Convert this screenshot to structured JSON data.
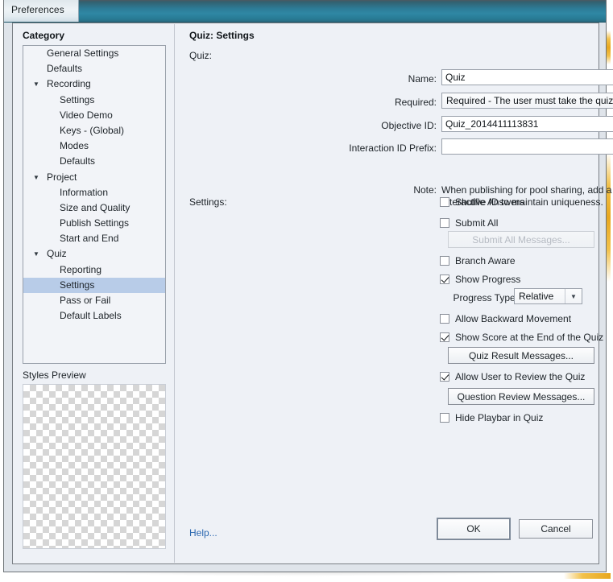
{
  "window": {
    "title": "Preferences"
  },
  "sidebar": {
    "header": "Category",
    "items": [
      {
        "label": "General Settings",
        "depth": 0,
        "twisty": "",
        "selected": false
      },
      {
        "label": "Defaults",
        "depth": 0,
        "twisty": "",
        "selected": false
      },
      {
        "label": "Recording",
        "depth": 0,
        "twisty": "▼",
        "selected": false
      },
      {
        "label": "Settings",
        "depth": 1,
        "twisty": "",
        "selected": false
      },
      {
        "label": "Video Demo",
        "depth": 1,
        "twisty": "",
        "selected": false
      },
      {
        "label": "Keys - (Global)",
        "depth": 1,
        "twisty": "",
        "selected": false
      },
      {
        "label": "Modes",
        "depth": 1,
        "twisty": "",
        "selected": false
      },
      {
        "label": "Defaults",
        "depth": 1,
        "twisty": "",
        "selected": false
      },
      {
        "label": "Project",
        "depth": 0,
        "twisty": "▼",
        "selected": false
      },
      {
        "label": "Information",
        "depth": 1,
        "twisty": "",
        "selected": false
      },
      {
        "label": "Size and Quality",
        "depth": 1,
        "twisty": "",
        "selected": false
      },
      {
        "label": "Publish Settings",
        "depth": 1,
        "twisty": "",
        "selected": false
      },
      {
        "label": "Start and End",
        "depth": 1,
        "twisty": "",
        "selected": false
      },
      {
        "label": "Quiz",
        "depth": 0,
        "twisty": "▼",
        "selected": false
      },
      {
        "label": "Reporting",
        "depth": 1,
        "twisty": "",
        "selected": false
      },
      {
        "label": "Settings",
        "depth": 1,
        "twisty": "",
        "selected": true
      },
      {
        "label": "Pass or Fail",
        "depth": 1,
        "twisty": "",
        "selected": false
      },
      {
        "label": "Default Labels",
        "depth": 1,
        "twisty": "",
        "selected": false
      }
    ],
    "styles_preview_label": "Styles Preview"
  },
  "pane": {
    "title": "Quiz: Settings",
    "quiz_group_label": "Quiz:",
    "settings_group_label": "Settings:",
    "fields": {
      "name_label": "Name:",
      "name_value": "Quiz",
      "required_label": "Required:",
      "required_value": "Required - The user must take the quiz to co...",
      "objective_label": "Objective ID:",
      "objective_value": "Quiz_2014411113831",
      "interaction_label": "Interaction ID Prefix:",
      "interaction_value": "",
      "note_label": "Note:",
      "note_text": "When publishing for pool sharing, add a prefix to the Interactive ID to maintain uniqueness."
    },
    "checkboxes": {
      "shuffle_answers": "Shuffle Answers",
      "submit_all": "Submit All",
      "branch_aware": "Branch Aware",
      "show_progress": "Show Progress",
      "allow_backward": "Allow Backward Movement",
      "show_score": "Show Score at the End of the Quiz",
      "allow_review": "Allow User to Review the Quiz",
      "hide_playbar": "Hide Playbar in Quiz"
    },
    "buttons": {
      "submit_all_messages": "Submit All Messages...",
      "quiz_result_messages": "Quiz Result Messages...",
      "question_review_messages": "Question Review Messages..."
    },
    "progress_type": {
      "label": "Progress Type:",
      "value": "Relative"
    }
  },
  "footer": {
    "help": "Help...",
    "ok": "OK",
    "cancel": "Cancel"
  },
  "colors": {
    "titlebar_accent": "#2f87a4",
    "selection": "#b8cce8",
    "link": "#2c68b0",
    "glow": "#e8a71e"
  }
}
